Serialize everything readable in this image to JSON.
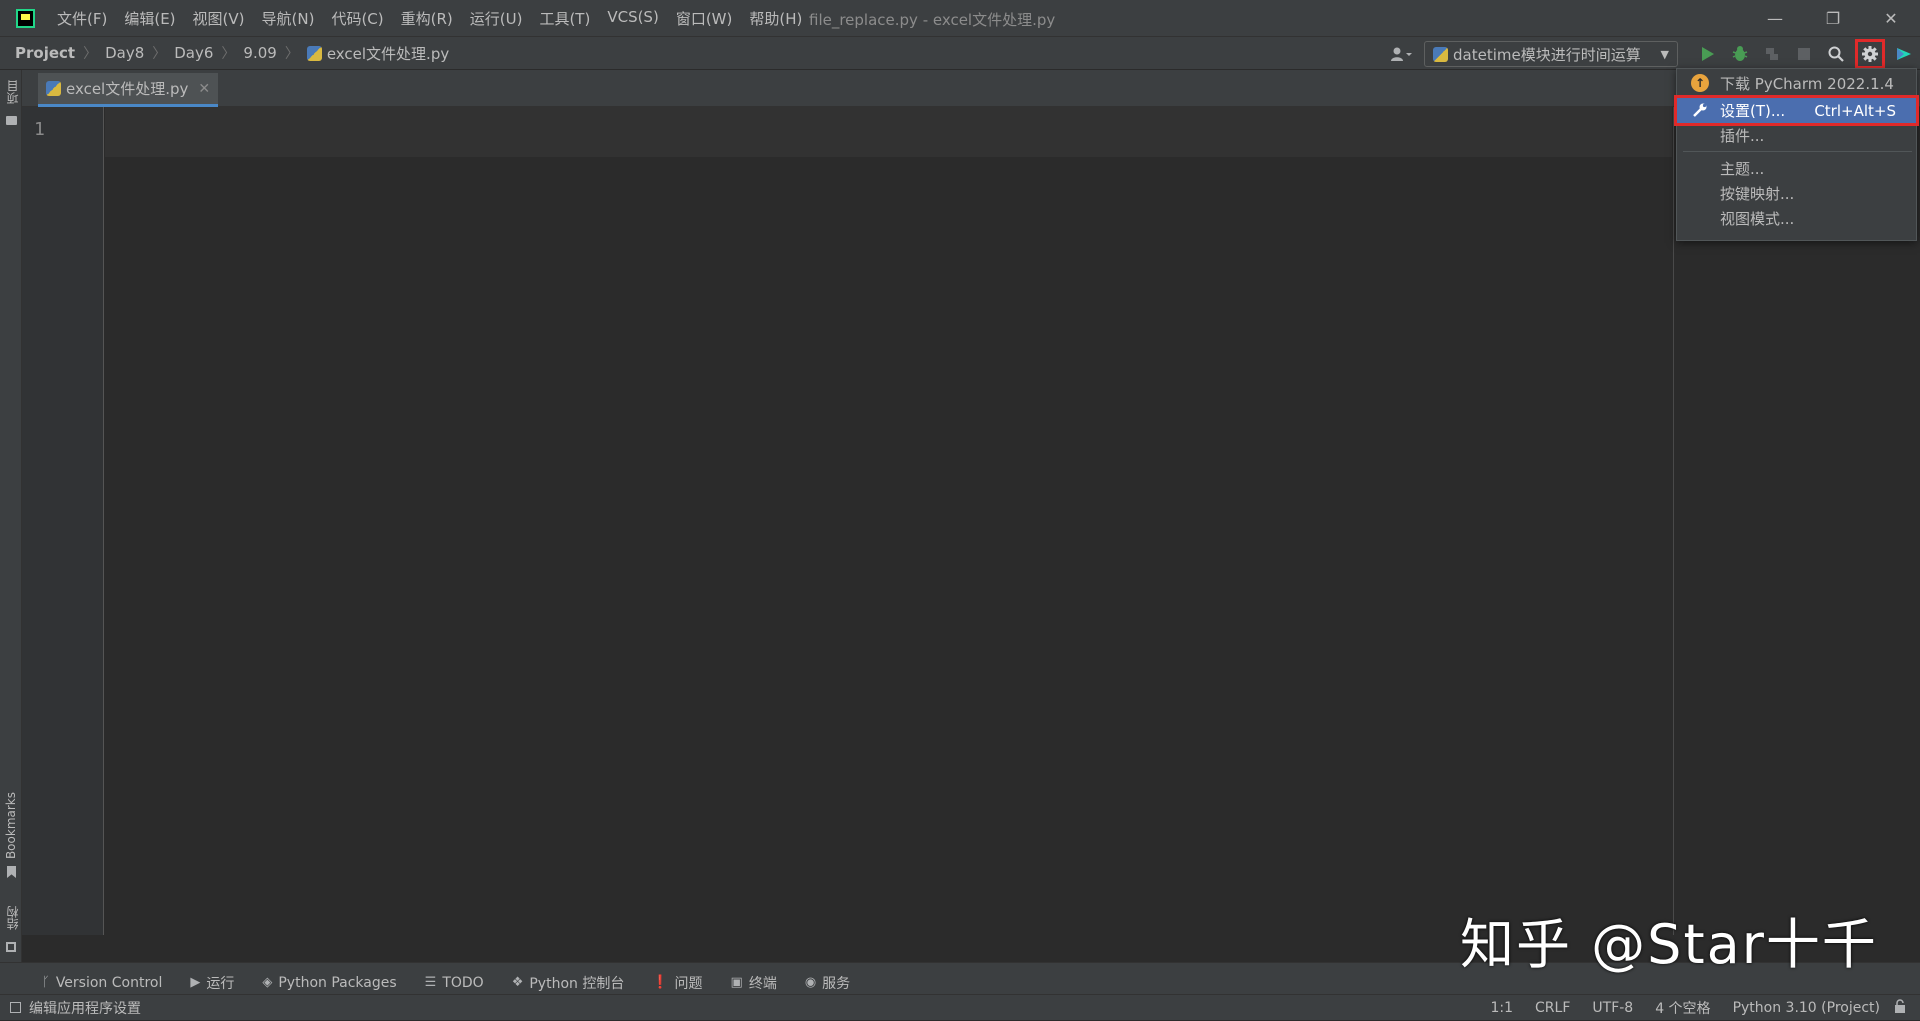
{
  "window": {
    "title": "file_replace.py - excel文件处理.py",
    "minimize": "—",
    "restore": "❐",
    "close": "✕"
  },
  "menu": [
    "文件(F)",
    "编辑(E)",
    "视图(V)",
    "导航(N)",
    "代码(C)",
    "重构(R)",
    "运行(U)",
    "工具(T)",
    "VCS(S)",
    "窗口(W)",
    "帮助(H)"
  ],
  "breadcrumb": {
    "project": "Project",
    "items": [
      "Day8",
      "Day6",
      "9.09"
    ],
    "file": "excel文件处理.py"
  },
  "toolbar": {
    "run_config": "datetime模块进行时间运算"
  },
  "left_strip": {
    "project": "项目",
    "bookmarks": "Bookmarks",
    "structure": "结构"
  },
  "tab": {
    "label": "excel文件处理.py",
    "close": "✕"
  },
  "editor": {
    "line_number": "1"
  },
  "dropdown": {
    "items": [
      {
        "label": "下载 PyCharm 2022.1.4",
        "shortcut": ""
      },
      {
        "label": "设置(T)...",
        "shortcut": "Ctrl+Alt+S"
      },
      {
        "label": "插件...",
        "shortcut": ""
      },
      {
        "label": "主题...",
        "shortcut": ""
      },
      {
        "label": "按键映射...",
        "shortcut": ""
      },
      {
        "label": "视图模式...",
        "shortcut": ""
      }
    ]
  },
  "bottom_tools": [
    "Version Control",
    "运行",
    "Python Packages",
    "TODO",
    "Python 控制台",
    "问题",
    "终端",
    "服务"
  ],
  "status": {
    "message": "编辑应用程序设置",
    "position": "1:1",
    "line_sep": "CRLF",
    "encoding": "UTF-8",
    "indent": "4 个空格",
    "interpreter": "Python 3.10 (Project)"
  },
  "watermark": "知乎 @Star十千",
  "colors": {
    "accent": "#4b6eaf",
    "highlight_box": "#e02a2a",
    "run_green": "#499c54"
  }
}
